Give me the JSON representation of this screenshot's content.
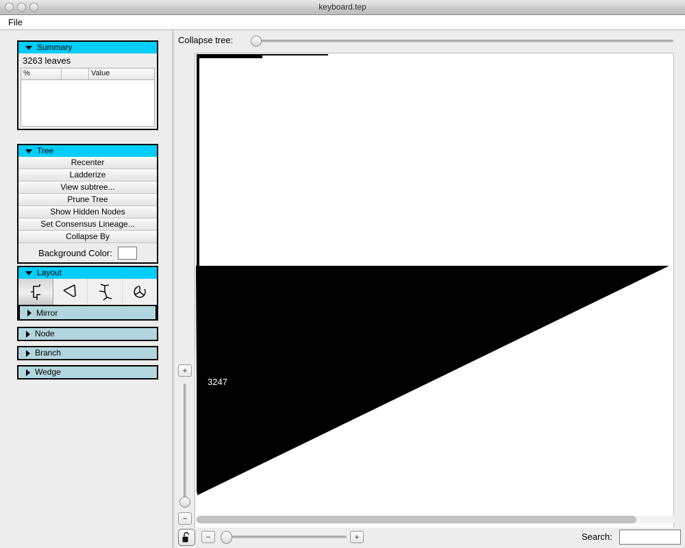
{
  "window": {
    "title": "keyboard.tep",
    "controls": [
      "close-button",
      "minimize-button",
      "zoom-button"
    ]
  },
  "menubar": {
    "items": [
      {
        "label": "File"
      }
    ]
  },
  "sidebar": {
    "summary": {
      "header_label": "Summary",
      "expanded": true,
      "leaves_text": "3263 leaves",
      "table": {
        "columns": [
          "%",
          "",
          "Value"
        ],
        "rows": []
      }
    },
    "tree": {
      "header_label": "Tree",
      "expanded": true,
      "buttons": [
        {
          "label": "Recenter"
        },
        {
          "label": "Ladderize"
        },
        {
          "label": "View subtree..."
        },
        {
          "label": "Prune Tree"
        },
        {
          "label": "Show Hidden Nodes"
        },
        {
          "label": "Set Consensus Lineage..."
        },
        {
          "label": "Collapse By"
        }
      ],
      "background_color_label": "Background Color:",
      "background_color_value": "#ffffff"
    },
    "layout": {
      "header_label": "Layout",
      "expanded": true,
      "modes": [
        {
          "name": "rectangular-layout-icon",
          "selected": true
        },
        {
          "name": "slanted-layout-icon",
          "selected": false
        },
        {
          "name": "radial-layout-icon",
          "selected": false
        },
        {
          "name": "circular-layout-icon",
          "selected": false
        }
      ],
      "mirror_label": "Mirror"
    },
    "collapsed_sections": [
      {
        "label": "Node"
      },
      {
        "label": "Branch"
      },
      {
        "label": "Wedge"
      }
    ]
  },
  "main": {
    "collapse_tree": {
      "label": "Collapse tree:",
      "value": 0,
      "min": 0,
      "max": 100
    },
    "tree_view": {
      "collapsed_clade_label": "3247",
      "clade_fill": "#000000",
      "background": "#ffffff"
    },
    "vertical_zoom": {
      "increase_label": "+",
      "decrease_label": "−",
      "value": 0
    },
    "horizontal_zoom": {
      "increase_label": "+",
      "decrease_label": "−",
      "value": 0
    },
    "horizontal_scroll": {
      "decrease_label": "−",
      "value": 0
    },
    "lock_button": {
      "name": "unlock-icon"
    },
    "search": {
      "label": "Search:",
      "value": "",
      "placeholder": ""
    }
  },
  "colors": {
    "panel_header": "#00cdfb",
    "panel_header_collapsed": "#b2d6de",
    "window_chrome": "#ededed"
  }
}
